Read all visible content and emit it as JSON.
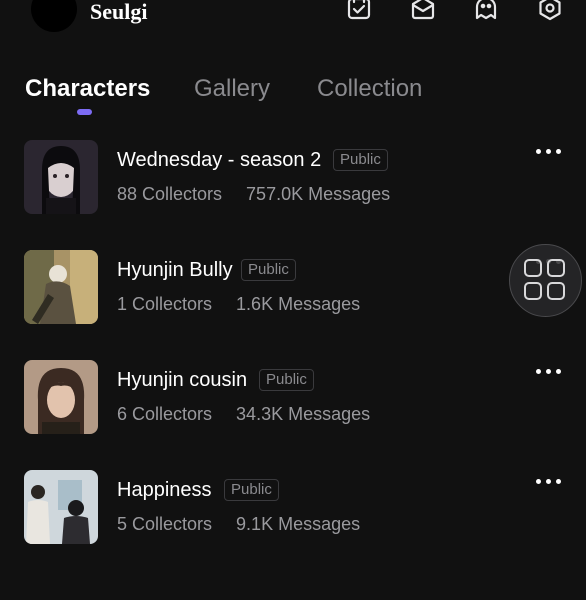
{
  "header": {
    "username": "Seulgi",
    "icons": [
      "calendar-check-icon",
      "mailbox-icon",
      "ghost-chat-icon",
      "settings-gear-icon"
    ]
  },
  "tabs": [
    {
      "label": "Characters",
      "active": true
    },
    {
      "label": "Gallery",
      "active": false
    },
    {
      "label": "Collection",
      "active": false
    }
  ],
  "characters": [
    {
      "title": "Wednesday - season 2",
      "visibility": "Public",
      "collectors": "88 Collectors",
      "messages": "757.0K Messages"
    },
    {
      "title": "Hyunjin Bully",
      "visibility": "Public",
      "collectors": "1 Collectors",
      "messages": "1.6K Messages"
    },
    {
      "title": "Hyunjin cousin",
      "visibility": "Public",
      "collectors": "6 Collectors",
      "messages": "34.3K Messages"
    },
    {
      "title": "Happiness",
      "visibility": "Public",
      "collectors": "5 Collectors",
      "messages": "9.1K Messages"
    }
  ],
  "colors": {
    "background": "#111111",
    "accent": "#7d6cf4",
    "muted_text": "#8a8a8e"
  }
}
